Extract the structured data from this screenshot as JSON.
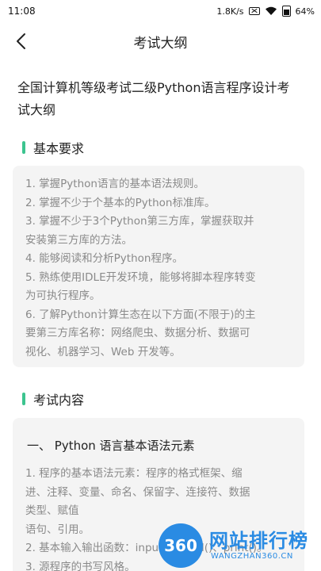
{
  "status_bar": {
    "time": "11:08",
    "speed": "1.8K/s",
    "battery": "64"
  },
  "nav": {
    "title": "考试大纲"
  },
  "page_title_lines": [
    "全国计算机等级考试二级Python语言程序设计考",
    "试大纲"
  ],
  "section1": {
    "heading": "基本要求",
    "lines": [
      "1. 掌握Python语言的基本语法规则。",
      "2. 掌握不少于个基本的Python标准库。",
      "3. 掌握不少于3个Python第三方库，掌握获取并",
      "安装第三方库的方法。",
      "4. 能够阅读和分析Python程序。",
      "5. 熟练使用IDLE开发环境，能够将脚本程序转变",
      "为可执行程序。",
      "6. 了解Python计算生态在以下方面(不限于)的主",
      "要第三方库名称：网络爬虫、数据分析、数据可",
      "视化、机器学习、Web 开发等。"
    ]
  },
  "section2": {
    "heading": "考试内容",
    "sub_heading": "一、 Python 语言基本语法元素",
    "lines": [
      "1. 程序的基本语法元素：程序的格式框架、缩",
      "进、注释、变量、命名、保留字、连接符、数据",
      "类型、赋值",
      "语句、引用。",
      "2. 基本输入输出函数：input()、eval()、print()。",
      "3. 源程序的书写风格。"
    ]
  },
  "watermark": {
    "logo": "360",
    "text": "网站排行榜",
    "sub": "WANGZHAN360.CN"
  }
}
